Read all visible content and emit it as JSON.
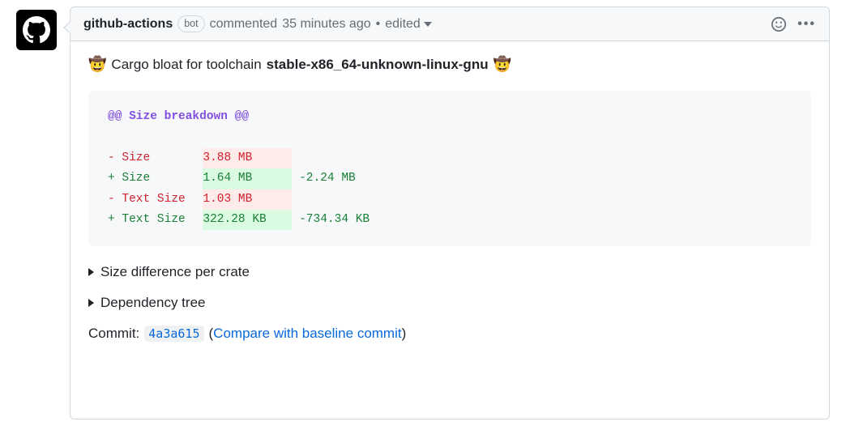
{
  "header": {
    "author": "github-actions",
    "bot_badge": "bot",
    "commented": "commented",
    "timestamp": "35 minutes ago",
    "separator": "•",
    "edited": "edited"
  },
  "body": {
    "emoji": "🤠",
    "title_prefix": "Cargo bloat for toolchain",
    "toolchain": "stable-x86_64-unknown-linux-gnu"
  },
  "diff": {
    "header": "@@ Size breakdown @@",
    "rows": [
      {
        "sign": "-",
        "label": "Size",
        "value": "3.88 MB",
        "delta": ""
      },
      {
        "sign": "+",
        "label": "Size",
        "value": "1.64 MB",
        "delta": "-2.24 MB"
      },
      {
        "sign": "-",
        "label": "Text Size",
        "value": "1.03 MB",
        "delta": ""
      },
      {
        "sign": "+",
        "label": "Text Size",
        "value": "322.28 KB",
        "delta": "-734.34 KB"
      }
    ]
  },
  "details": {
    "size_per_crate": "Size difference per crate",
    "dep_tree": "Dependency tree"
  },
  "commit": {
    "label": "Commit:",
    "hash": "4a3a615",
    "compare_open": "(",
    "compare_link": "Compare with baseline commit",
    "compare_close": ")"
  }
}
